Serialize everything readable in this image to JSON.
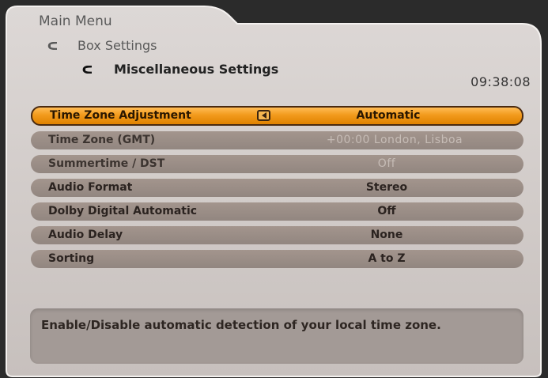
{
  "breadcrumb": {
    "level1": "Main Menu",
    "level2": "Box Settings",
    "level3": "Miscellaneous Settings"
  },
  "clock": "09:38:08",
  "menu": [
    {
      "label": "Time Zone Adjustment",
      "value": "Automatic",
      "state": "selected"
    },
    {
      "label": "Time Zone (GMT)",
      "value": "+00:00  London, Lisboa",
      "state": "disabled"
    },
    {
      "label": "Summertime / DST",
      "value": "Off",
      "state": "disabled"
    },
    {
      "label": "Audio Format",
      "value": "Stereo",
      "state": "normal"
    },
    {
      "label": "Dolby Digital Automatic",
      "value": "Off",
      "state": "normal"
    },
    {
      "label": "Audio Delay",
      "value": "None",
      "state": "normal"
    },
    {
      "label": "Sorting",
      "value": "A to Z",
      "state": "normal"
    }
  ],
  "help": "Enable/Disable automatic detection of your local time zone.",
  "colors": {
    "panel": "#cfc9c7",
    "selected": "#f29a1c",
    "row": "#9b8e88",
    "help_box": "#a39a96"
  },
  "icons": {
    "crumb": "return-arrow-icon",
    "left_arrow": "left-arrow-icon"
  }
}
